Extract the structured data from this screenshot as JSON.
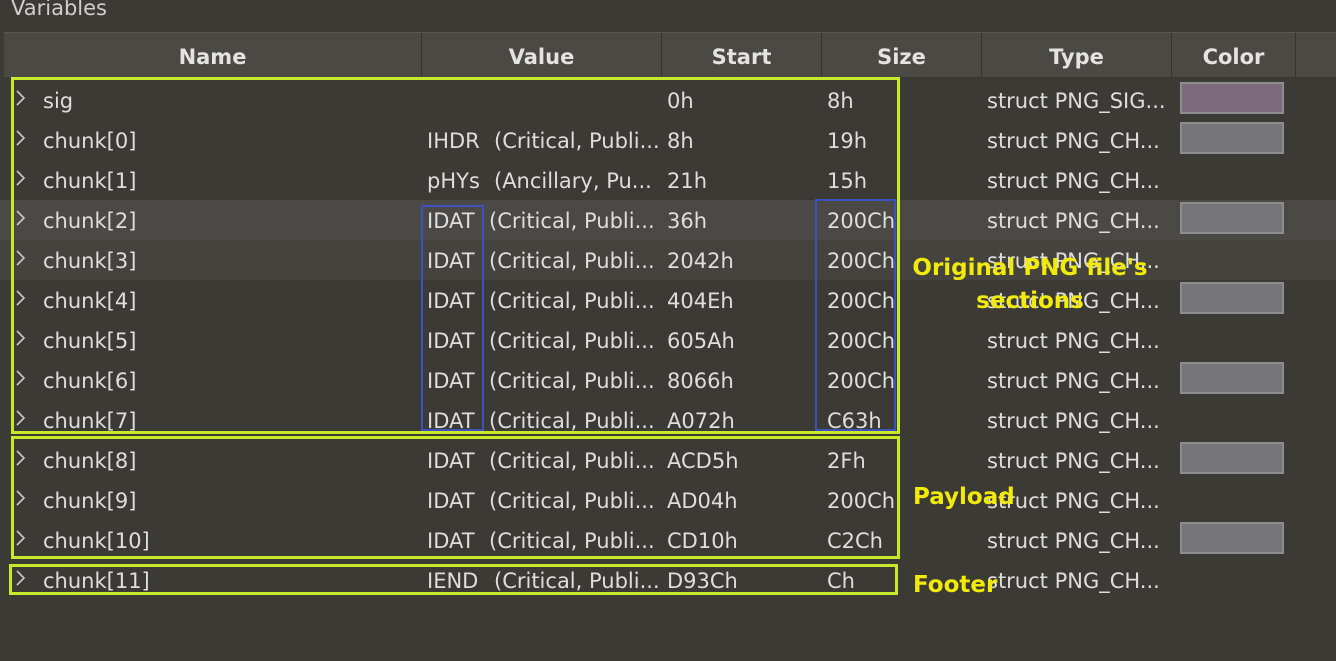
{
  "panel_title": "Variables",
  "columns": [
    "Name",
    "Value",
    "Start",
    "Size",
    "Type",
    "Color"
  ],
  "rows": [
    {
      "name": "sig",
      "value_tag": "",
      "value_rest": "",
      "start": "0h",
      "size": "8h",
      "type": "struct PNG_SIG...",
      "swatch": "#7d6b7c"
    },
    {
      "name": "chunk[0]",
      "value_tag": "IHDR",
      "value_rest": "(Critical, Publi...",
      "start": "8h",
      "size": "19h",
      "type": "struct PNG_CH...",
      "swatch": "#767578"
    },
    {
      "name": "chunk[1]",
      "value_tag": "pHYs",
      "value_rest": "(Ancillary, Pu...",
      "start": "21h",
      "size": "15h",
      "type": "struct PNG_CH...",
      "swatch": ""
    },
    {
      "name": "chunk[2]",
      "value_tag": "IDAT",
      "value_rest": "(Critical, Publi...",
      "start": "36h",
      "size": "200Ch",
      "type": "struct PNG_CH...",
      "swatch": "#767578"
    },
    {
      "name": "chunk[3]",
      "value_tag": "IDAT",
      "value_rest": "(Critical, Publi...",
      "start": "2042h",
      "size": "200Ch",
      "type": "struct PNG_CH...",
      "swatch": ""
    },
    {
      "name": "chunk[4]",
      "value_tag": "IDAT",
      "value_rest": "(Critical, Publi...",
      "start": "404Eh",
      "size": "200Ch",
      "type": "struct PNG_CH...",
      "swatch": "#767578"
    },
    {
      "name": "chunk[5]",
      "value_tag": "IDAT",
      "value_rest": "(Critical, Publi...",
      "start": "605Ah",
      "size": "200Ch",
      "type": "struct PNG_CH...",
      "swatch": ""
    },
    {
      "name": "chunk[6]",
      "value_tag": "IDAT",
      "value_rest": "(Critical, Publi...",
      "start": "8066h",
      "size": "200Ch",
      "type": "struct PNG_CH...",
      "swatch": "#767578"
    },
    {
      "name": "chunk[7]",
      "value_tag": "IDAT",
      "value_rest": "(Critical, Publi...",
      "start": "A072h",
      "size": "C63h",
      "type": "struct PNG_CH...",
      "swatch": ""
    },
    {
      "name": "chunk[8]",
      "value_tag": "IDAT",
      "value_rest": "(Critical, Publi...",
      "start": "ACD5h",
      "size": "2Fh",
      "type": "struct PNG_CH...",
      "swatch": "#767578"
    },
    {
      "name": "chunk[9]",
      "value_tag": "IDAT",
      "value_rest": "(Critical, Publi...",
      "start": "AD04h",
      "size": "200Ch",
      "type": "struct PNG_CH...",
      "swatch": ""
    },
    {
      "name": "chunk[10]",
      "value_tag": "IDAT",
      "value_rest": "(Critical, Publi...",
      "start": "CD10h",
      "size": "C2Ch",
      "type": "struct PNG_CH...",
      "swatch": "#767578"
    },
    {
      "name": "chunk[11]",
      "value_tag": "IEND",
      "value_rest": "(Critical, Publi...",
      "start": "D93Ch",
      "size": "Ch",
      "type": "struct PNG_CH...",
      "swatch": ""
    }
  ],
  "annotations": {
    "original": "Original PNG file's sections",
    "payload": "Payload",
    "footer": "Footer"
  },
  "colors": {
    "highlight_box": "#c6ea2a",
    "idat_box": "#3e4fbf",
    "annotation_text": "#f2ea0a"
  },
  "icons": {
    "row_expander": "chevron-right-icon"
  }
}
